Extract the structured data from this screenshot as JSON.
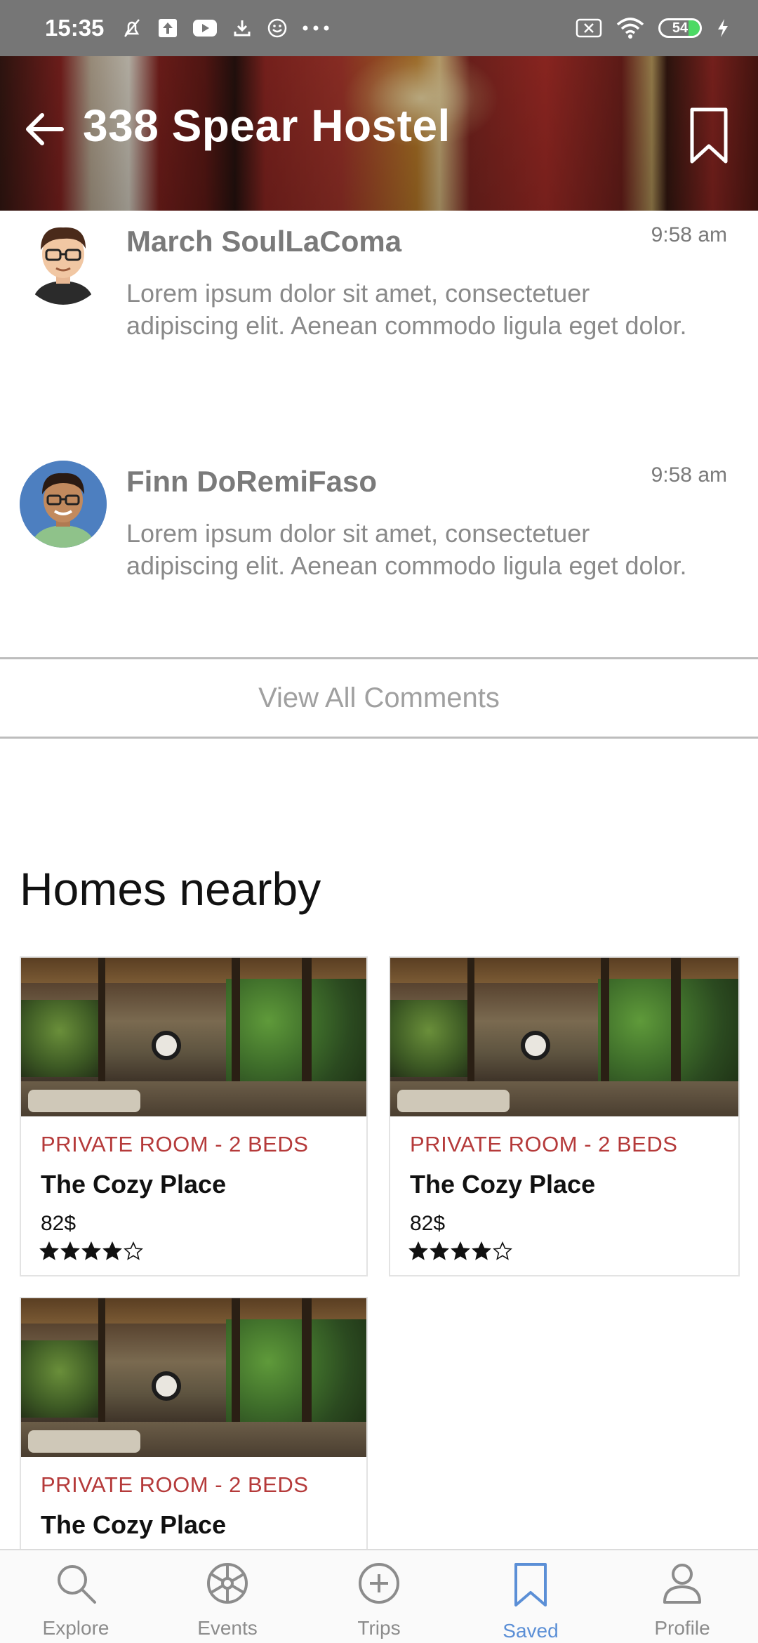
{
  "status_bar": {
    "time": "15:35",
    "battery": "54"
  },
  "header": {
    "title": "338 Spear Hostel"
  },
  "comments": [
    {
      "author": "March SoulLaComa",
      "time": "9:58 am",
      "text": "Lorem ipsum dolor sit amet, consectetuer adipiscing elit. Aenean commodo ligula eget dolor."
    },
    {
      "author": "Finn DoRemiFaso",
      "time": "9:58 am",
      "text": "Lorem ipsum dolor sit amet, consectetuer adipiscing elit. Aenean commodo ligula eget dolor."
    }
  ],
  "view_all_label": "View All Comments",
  "nearby": {
    "title": "Homes nearby",
    "cards": [
      {
        "category": "PRIVATE ROOM - 2 BEDS",
        "name": "The Cozy Place",
        "price": "82$",
        "rating": 4,
        "max_rating": 5
      },
      {
        "category": "PRIVATE ROOM - 2 BEDS",
        "name": "The Cozy Place",
        "price": "82$",
        "rating": 4,
        "max_rating": 5
      },
      {
        "category": "PRIVATE ROOM - 2 BEDS",
        "name": "The Cozy Place"
      }
    ]
  },
  "bottom_nav": {
    "items": [
      {
        "label": "Explore",
        "icon": "search-icon"
      },
      {
        "label": "Events",
        "icon": "events-wheel-icon"
      },
      {
        "label": "Trips",
        "icon": "plus-circle-icon"
      },
      {
        "label": "Saved",
        "icon": "bookmark-icon",
        "active": true
      },
      {
        "label": "Profile",
        "icon": "profile-icon"
      }
    ],
    "active_color": "#5b8fd6"
  },
  "colors": {
    "category_text": "#b53a3a",
    "status_bar": "#767676"
  }
}
